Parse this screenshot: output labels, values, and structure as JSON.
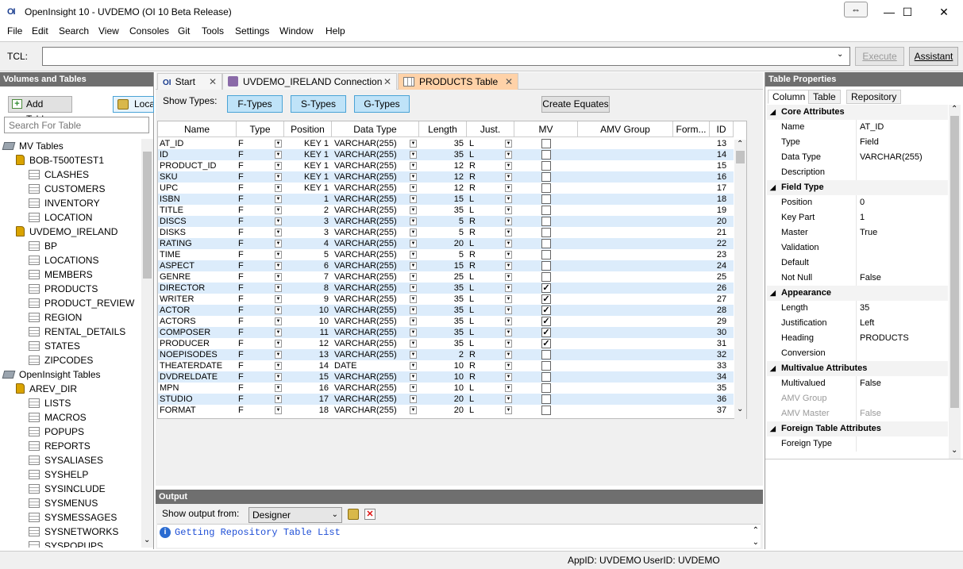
{
  "window": {
    "title": "OpenInsight 10 - UVDEMO (OI 10 Beta Release)",
    "logo": "OI",
    "minimize": "—",
    "maximize": "☐",
    "close": "✕",
    "restore_icon": "⇔"
  },
  "menu": [
    "File",
    "Edit",
    "Search",
    "View",
    "Consoles",
    "Git",
    "Tools",
    "Settings",
    "Window",
    "Help"
  ],
  "tcl": {
    "label": "TCL:",
    "value": "",
    "execute": "Execute",
    "assistant": "Assistant"
  },
  "left": {
    "header": "Volumes and Tables",
    "add_tables": "Add Tables",
    "local": "Loca",
    "search_placeholder": "Search For Table",
    "tree": [
      {
        "label": "MV Tables",
        "type": "mv",
        "indent": 0
      },
      {
        "label": "BOB-T500TEST1",
        "type": "vol",
        "indent": 1
      },
      {
        "label": "CLASHES",
        "type": "tbl",
        "indent": 2
      },
      {
        "label": "CUSTOMERS",
        "type": "tbl",
        "indent": 2
      },
      {
        "label": "INVENTORY",
        "type": "tbl",
        "indent": 2
      },
      {
        "label": "LOCATION",
        "type": "tbl",
        "indent": 2
      },
      {
        "label": "UVDEMO_IRELAND",
        "type": "vol",
        "indent": 1
      },
      {
        "label": "BP",
        "type": "tbl",
        "indent": 2
      },
      {
        "label": "LOCATIONS",
        "type": "tbl",
        "indent": 2
      },
      {
        "label": "MEMBERS",
        "type": "tbl",
        "indent": 2
      },
      {
        "label": "PRODUCTS",
        "type": "tbl",
        "indent": 2
      },
      {
        "label": "PRODUCT_REVIEW",
        "type": "tbl",
        "indent": 2
      },
      {
        "label": "REGION",
        "type": "tbl",
        "indent": 2
      },
      {
        "label": "RENTAL_DETAILS",
        "type": "tbl",
        "indent": 2
      },
      {
        "label": "STATES",
        "type": "tbl",
        "indent": 2
      },
      {
        "label": "ZIPCODES",
        "type": "tbl",
        "indent": 2
      },
      {
        "label": "OpenInsight Tables",
        "type": "mv",
        "indent": 0
      },
      {
        "label": "AREV_DIR",
        "type": "vol",
        "indent": 1
      },
      {
        "label": "LISTS",
        "type": "tbl",
        "indent": 2
      },
      {
        "label": "MACROS",
        "type": "tbl",
        "indent": 2
      },
      {
        "label": "POPUPS",
        "type": "tbl",
        "indent": 2
      },
      {
        "label": "REPORTS",
        "type": "tbl",
        "indent": 2
      },
      {
        "label": "SYSALIASES",
        "type": "tbl",
        "indent": 2
      },
      {
        "label": "SYSHELP",
        "type": "tbl",
        "indent": 2
      },
      {
        "label": "SYSINCLUDE",
        "type": "tbl",
        "indent": 2
      },
      {
        "label": "SYSMENUS",
        "type": "tbl",
        "indent": 2
      },
      {
        "label": "SYSMESSAGES",
        "type": "tbl",
        "indent": 2
      },
      {
        "label": "SYSNETWORKS",
        "type": "tbl",
        "indent": 2
      },
      {
        "label": "SYSPOPUPS",
        "type": "tbl",
        "indent": 2
      }
    ]
  },
  "tabs": [
    {
      "label": "Start",
      "icon": "oi-logo-icon"
    },
    {
      "label": "UVDEMO_IRELAND Connection",
      "icon": "connection-icon"
    },
    {
      "label": "PRODUCTS Table",
      "icon": "table-icon"
    }
  ],
  "toolbar": {
    "show_types": "Show Types:",
    "f_types": "F-Types",
    "s_types": "S-Types",
    "g_types": "G-Types",
    "create_equates": "Create Equates"
  },
  "grid": {
    "headers": [
      "Name",
      "Type",
      "Position",
      "Data Type",
      "Length",
      "Just.",
      "MV",
      "AMV Group",
      "Form...",
      "ID"
    ],
    "rows": [
      [
        "AT_ID",
        "F",
        "KEY 1",
        "VARCHAR(255)",
        "35",
        "L",
        false,
        "13"
      ],
      [
        "ID",
        "F",
        "KEY 1",
        "VARCHAR(255)",
        "35",
        "L",
        false,
        "14"
      ],
      [
        "PRODUCT_ID",
        "F",
        "KEY 1",
        "VARCHAR(255)",
        "12",
        "R",
        false,
        "15"
      ],
      [
        "SKU",
        "F",
        "KEY 1",
        "VARCHAR(255)",
        "12",
        "R",
        false,
        "16"
      ],
      [
        "UPC",
        "F",
        "KEY 1",
        "VARCHAR(255)",
        "12",
        "R",
        false,
        "17"
      ],
      [
        "ISBN",
        "F",
        "1",
        "VARCHAR(255)",
        "15",
        "L",
        false,
        "18"
      ],
      [
        "TITLE",
        "F",
        "2",
        "VARCHAR(255)",
        "35",
        "L",
        false,
        "19"
      ],
      [
        "DISCS",
        "F",
        "3",
        "VARCHAR(255)",
        "5",
        "R",
        false,
        "20"
      ],
      [
        "DISKS",
        "F",
        "3",
        "VARCHAR(255)",
        "5",
        "R",
        false,
        "21"
      ],
      [
        "RATING",
        "F",
        "4",
        "VARCHAR(255)",
        "20",
        "L",
        false,
        "22"
      ],
      [
        "TIME",
        "F",
        "5",
        "VARCHAR(255)",
        "5",
        "R",
        false,
        "23"
      ],
      [
        "ASPECT",
        "F",
        "6",
        "VARCHAR(255)",
        "15",
        "R",
        false,
        "24"
      ],
      [
        "GENRE",
        "F",
        "7",
        "VARCHAR(255)",
        "25",
        "L",
        false,
        "25"
      ],
      [
        "DIRECTOR",
        "F",
        "8",
        "VARCHAR(255)",
        "35",
        "L",
        true,
        "26"
      ],
      [
        "WRITER",
        "F",
        "9",
        "VARCHAR(255)",
        "35",
        "L",
        true,
        "27"
      ],
      [
        "ACTOR",
        "F",
        "10",
        "VARCHAR(255)",
        "35",
        "L",
        true,
        "28"
      ],
      [
        "ACTORS",
        "F",
        "10",
        "VARCHAR(255)",
        "35",
        "L",
        true,
        "29"
      ],
      [
        "COMPOSER",
        "F",
        "11",
        "VARCHAR(255)",
        "35",
        "L",
        true,
        "30"
      ],
      [
        "PRODUCER",
        "F",
        "12",
        "VARCHAR(255)",
        "35",
        "L",
        true,
        "31"
      ],
      [
        "NOEPISODES",
        "F",
        "13",
        "VARCHAR(255)",
        "2",
        "R",
        false,
        "32"
      ],
      [
        "THEATERDATE",
        "F",
        "14",
        "DATE",
        "10",
        "R",
        false,
        "33"
      ],
      [
        "DVDRELDATE",
        "F",
        "15",
        "VARCHAR(255)",
        "10",
        "R",
        false,
        "34"
      ],
      [
        "MPN",
        "F",
        "16",
        "VARCHAR(255)",
        "10",
        "L",
        false,
        "35"
      ],
      [
        "STUDIO",
        "F",
        "17",
        "VARCHAR(255)",
        "20",
        "L",
        false,
        "36"
      ],
      [
        "FORMAT",
        "F",
        "18",
        "VARCHAR(255)",
        "20",
        "L",
        false,
        "37"
      ]
    ]
  },
  "output": {
    "header": "Output",
    "show_from": "Show output from:",
    "source": "Designer",
    "message": "Getting Repository Table List"
  },
  "props": {
    "header": "Table Properties",
    "tabs": [
      "Column",
      "Table",
      "Repository"
    ],
    "rows": [
      {
        "sec": true,
        "name": "Core Attributes"
      },
      {
        "name": "Name",
        "value": "AT_ID"
      },
      {
        "name": "Type",
        "value": "Field"
      },
      {
        "name": "Data Type",
        "value": "VARCHAR(255)"
      },
      {
        "name": "Description",
        "value": ""
      },
      {
        "sec": true,
        "name": "Field Type"
      },
      {
        "name": "Position",
        "value": "0"
      },
      {
        "name": "Key Part",
        "value": "1"
      },
      {
        "name": "Master",
        "value": "True"
      },
      {
        "name": "Validation",
        "value": ""
      },
      {
        "name": "Default",
        "value": ""
      },
      {
        "name": "Not Null",
        "value": "False"
      },
      {
        "sec": true,
        "name": "Appearance"
      },
      {
        "name": "Length",
        "value": "35"
      },
      {
        "name": "Justification",
        "value": "Left"
      },
      {
        "name": "Heading",
        "value": "PRODUCTS"
      },
      {
        "name": "Conversion",
        "value": ""
      },
      {
        "sec": true,
        "name": "Multivalue Attributes"
      },
      {
        "name": "Multivalued",
        "value": "False"
      },
      {
        "name": "AMV Group",
        "value": "",
        "gray": true
      },
      {
        "name": "AMV Master",
        "value": "False",
        "gray": true
      },
      {
        "sec": true,
        "name": "Foreign Table Attributes"
      },
      {
        "name": "Foreign Type",
        "value": ""
      }
    ]
  },
  "status": {
    "app": "AppID: UVDEMO",
    "user": "UserID: UVDEMO"
  }
}
